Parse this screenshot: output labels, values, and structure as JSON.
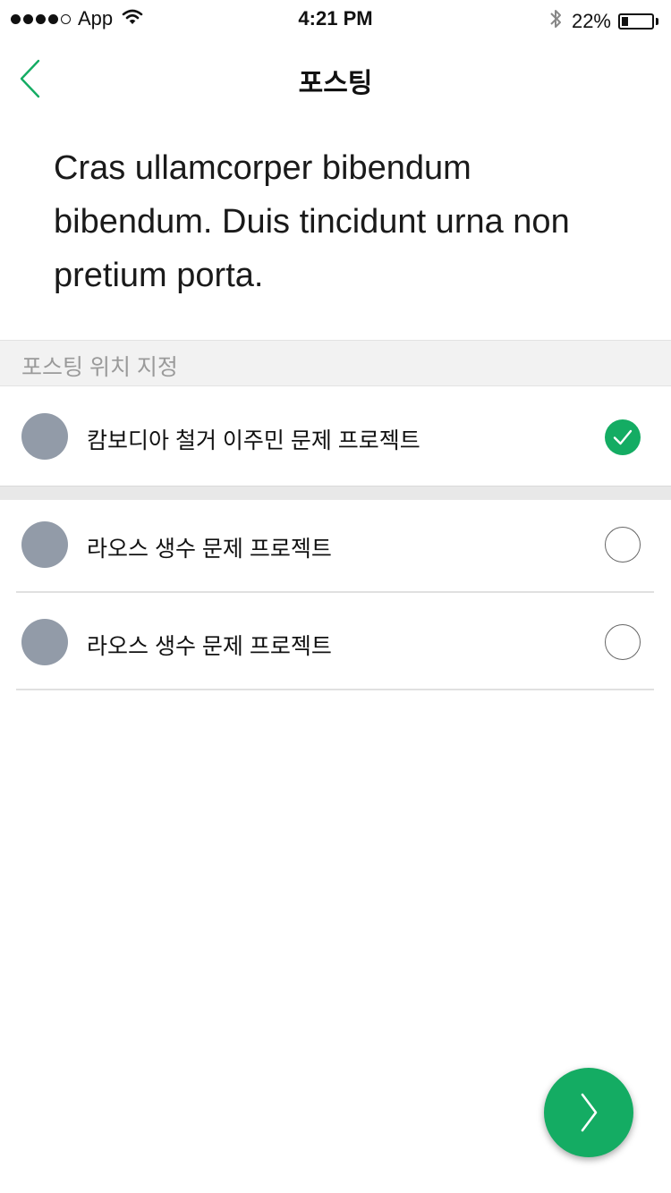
{
  "status_bar": {
    "carrier": "App",
    "time": "4:21 PM",
    "battery_percent": "22%",
    "battery_level": 0.22,
    "signal_bars": 4
  },
  "nav": {
    "title": "포스팅",
    "back_icon": "chevron-left-icon"
  },
  "post": {
    "text": "Cras ullamcorper bibendum bibendum. Duis tincidunt urna non pretium porta."
  },
  "section": {
    "title": "포스팅 위치 지정"
  },
  "projects": [
    {
      "label": "캄보디아 철거 이주민 문제 프로젝트",
      "selected": true
    },
    {
      "label": "라오스 생수 문제 프로젝트",
      "selected": false
    },
    {
      "label": "라오스 생수 문제 프로젝트",
      "selected": false
    }
  ],
  "colors": {
    "accent": "#14ac63",
    "avatar": "#929ba8",
    "section_text": "#9a9a9a"
  },
  "fab": {
    "icon": "chevron-right-icon"
  }
}
